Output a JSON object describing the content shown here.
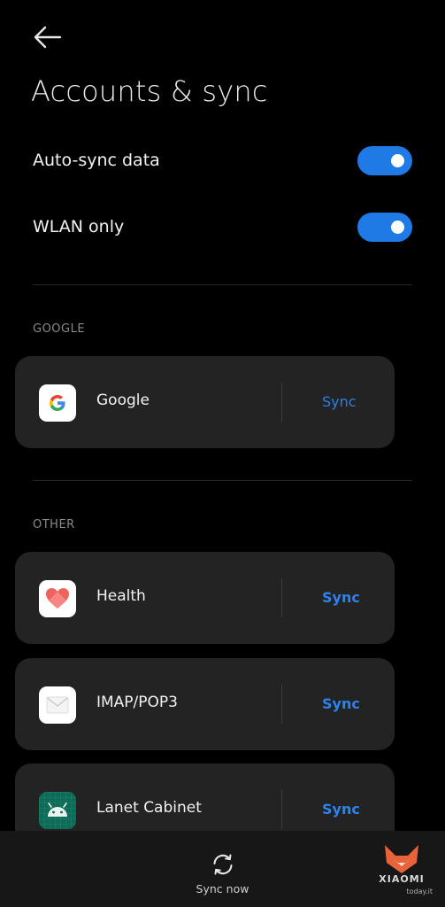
{
  "header": {
    "title": "Accounts & sync",
    "back_icon": "back-arrow-icon"
  },
  "settings": [
    {
      "label": "Auto-sync data",
      "enabled": true
    },
    {
      "label": "WLAN only",
      "enabled": true
    }
  ],
  "sections": {
    "google": {
      "title": "GOOGLE",
      "accounts": [
        {
          "name": "Google",
          "action": "Sync",
          "icon": "google-icon"
        }
      ]
    },
    "other": {
      "title": "OTHER",
      "accounts": [
        {
          "name": "Health",
          "action": "Sync",
          "icon": "health-heart-icon"
        },
        {
          "name": "IMAP/POP3",
          "action": "Sync",
          "icon": "mail-envelope-icon"
        },
        {
          "name": "Lanet Cabinet",
          "action": "Sync",
          "icon": "android-icon"
        }
      ]
    }
  },
  "bottom_bar": {
    "label": "Sync now",
    "icon": "sync-icon"
  },
  "watermark": {
    "brand": "XIAOMI",
    "sub": "today.it"
  },
  "colors": {
    "accent": "#1f7ae6",
    "background": "#000000",
    "card": "#232323"
  }
}
